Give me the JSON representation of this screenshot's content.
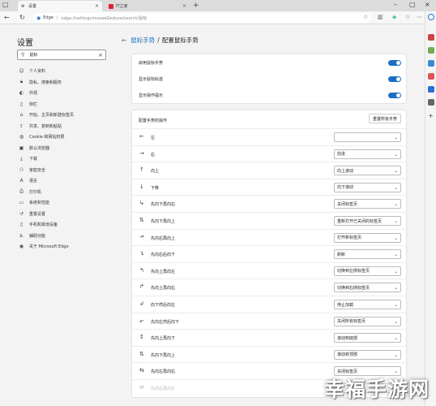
{
  "browser": {
    "tabs": [
      {
        "label": "设置",
        "icon": "settings-icon",
        "active": true
      },
      {
        "label": "IT之家",
        "icon": "ithome-icon",
        "active": false
      }
    ],
    "url_host": "Edge",
    "url_separator": "|",
    "url_path": "edge://settings/mouseGesture/search/鼠标"
  },
  "sidebar": {
    "title": "设置",
    "search_value": "鼠标",
    "items": [
      {
        "label": "个人资料",
        "icon": "person-icon"
      },
      {
        "label": "隐私、搜索和服务",
        "icon": "lock-icon"
      },
      {
        "label": "外观",
        "icon": "appearance-icon"
      },
      {
        "label": "侧栏",
        "icon": "sidebar-icon"
      },
      {
        "label": "开始、主页和新建标签页",
        "icon": "home-icon"
      },
      {
        "label": "共享、复制和粘贴",
        "icon": "share-icon"
      },
      {
        "label": "Cookie 和网站权限",
        "icon": "cookie-icon"
      },
      {
        "label": "默认浏览器",
        "icon": "browser-icon"
      },
      {
        "label": "下载",
        "icon": "download-icon"
      },
      {
        "label": "家庭安全",
        "icon": "family-icon"
      },
      {
        "label": "语言",
        "icon": "language-icon"
      },
      {
        "label": "打印机",
        "icon": "printer-icon"
      },
      {
        "label": "系统和性能",
        "icon": "system-icon"
      },
      {
        "label": "重置设置",
        "icon": "reset-icon"
      },
      {
        "label": "手机和其他设备",
        "icon": "phone-icon"
      },
      {
        "label": "辅助功能",
        "icon": "accessibility-icon"
      },
      {
        "label": "关于 Microsoft Edge",
        "icon": "edge-icon"
      }
    ]
  },
  "main": {
    "breadcrumb_parent": "鼠标手势",
    "breadcrumb_sep": "/",
    "breadcrumb_current": "配置鼠标手势",
    "toggles": [
      {
        "label": "启用鼠标手势",
        "on": true
      },
      {
        "label": "显示鼠标轨迹",
        "on": true
      },
      {
        "label": "显示操作提示",
        "on": true
      }
    ],
    "gestures_heading": "配置手势的操作",
    "reset_button": "重置所有手势",
    "gestures": [
      {
        "label": "左",
        "icon": "arrow-left-icon",
        "action": ""
      },
      {
        "label": "右",
        "icon": "arrow-right-icon",
        "action": "前进"
      },
      {
        "label": "向上",
        "icon": "arrow-up-icon",
        "action": "向上滚动"
      },
      {
        "label": "下移",
        "icon": "arrow-down-icon",
        "action": "向下滚动"
      },
      {
        "label": "先向下再向右",
        "icon": "down-right-icon",
        "action": "关闭标签页"
      },
      {
        "label": "先向下再向上",
        "icon": "down-up-icon",
        "action": "重新打开已关闭的标签页"
      },
      {
        "label": "先向右再向上",
        "icon": "right-up-icon",
        "action": "打开新标签页"
      },
      {
        "label": "先向右后向下",
        "icon": "right-down-icon",
        "action": "刷新"
      },
      {
        "label": "先向上再向左",
        "icon": "up-left-icon",
        "action": "切换到左侧标签页"
      },
      {
        "label": "先向上再向右",
        "icon": "up-right-icon",
        "action": "切换到右侧标签页"
      },
      {
        "label": "向下然后向左",
        "icon": "down-left-icon",
        "action": "停止加载"
      },
      {
        "label": "先向左然后向下",
        "icon": "left-down-icon",
        "action": "关闭所有标签页"
      },
      {
        "label": "先向上再向下",
        "icon": "up-down-icon",
        "action": "滚动到底部"
      },
      {
        "label": "先向下再向上",
        "icon": "down-up-icon",
        "action": "滚动到顶部"
      },
      {
        "label": "先向左再向右",
        "icon": "left-right-icon",
        "action": "关闭标签页"
      },
      {
        "label": "先向右再向左",
        "icon": "right-left-icon",
        "action": ""
      }
    ]
  },
  "watermark": "幸福手游网",
  "colors": {
    "accent": "#1a6fc4",
    "page_bg": "#f3f3f3",
    "card_bg": "#ffffff"
  }
}
